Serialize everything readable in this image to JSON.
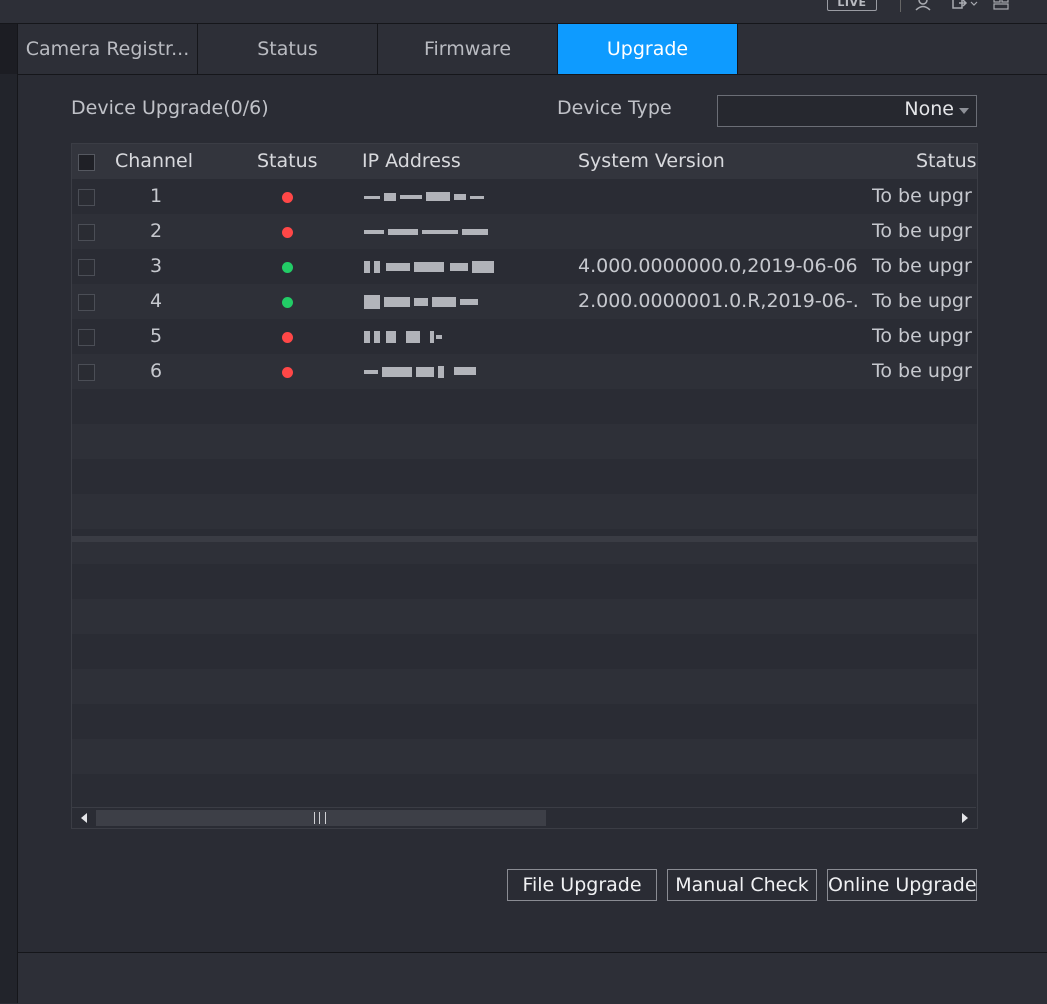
{
  "topbar": {
    "live_label": "LIVE",
    "icons": [
      "user-icon",
      "logout-icon",
      "layout-icon"
    ]
  },
  "tabs": [
    {
      "label": "Camera Registr...",
      "active": false
    },
    {
      "label": "Status",
      "active": false
    },
    {
      "label": "Firmware",
      "active": false
    },
    {
      "label": "Upgrade",
      "active": true
    }
  ],
  "main": {
    "device_upgrade_label": "Device Upgrade(0/6)",
    "device_type_label": "Device Type",
    "device_type_value": "None"
  },
  "table": {
    "columns": [
      "Channel",
      "Status",
      "IP Address",
      "System Version",
      "Status"
    ],
    "rows": [
      {
        "channel": "1",
        "status": "offline",
        "system_version": "",
        "upgrade_status": "To be upgr"
      },
      {
        "channel": "2",
        "status": "offline",
        "system_version": "",
        "upgrade_status": "To be upgr"
      },
      {
        "channel": "3",
        "status": "online",
        "system_version": "4.000.0000000.0,2019-06-06",
        "upgrade_status": "To be upgr"
      },
      {
        "channel": "4",
        "status": "online",
        "system_version": "2.000.0000001.0.R,2019-06-...",
        "upgrade_status": "To be upgr"
      },
      {
        "channel": "5",
        "status": "offline",
        "system_version": "",
        "upgrade_status": "To be upgr"
      },
      {
        "channel": "6",
        "status": "offline",
        "system_version": "",
        "upgrade_status": "To be upgr"
      }
    ]
  },
  "status_colors": {
    "online": "#22cc66",
    "offline": "#ff4747"
  },
  "buttons": {
    "file_upgrade": "File Upgrade",
    "manual_check": "Manual Check",
    "online_upgrade": "Online Upgrade"
  },
  "colors": {
    "accent": "#0e9bff",
    "background": "#2a2c34"
  }
}
